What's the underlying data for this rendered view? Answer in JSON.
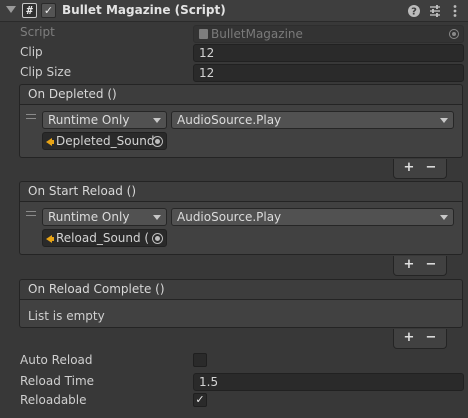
{
  "component": {
    "title": "Bullet Magazine (Script)",
    "enabled_check": "✓",
    "script_glyph": "#",
    "header_icons": [
      "help-icon",
      "preset-sliders-icon",
      "context-menu-icon"
    ]
  },
  "props": {
    "script_label": "Script",
    "script_value": "BulletMagazine",
    "clip_label": "Clip",
    "clip_value": "12",
    "clip_size_label": "Clip Size",
    "clip_size_value": "12",
    "auto_reload_label": "Auto Reload",
    "auto_reload_checked": false,
    "reload_time_label": "Reload Time",
    "reload_time_value": "1.5",
    "reloadable_label": "Reloadable",
    "reloadable_check": "✓"
  },
  "events": {
    "depleted": {
      "header": "On Depleted ()",
      "mode": "Runtime Only",
      "function": "AudioSource.Play",
      "target": "Depleted_Sound"
    },
    "start_reload": {
      "header": "On Start Reload ()",
      "mode": "Runtime Only",
      "function": "AudioSource.Play",
      "target": "Reload_Sound ("
    },
    "reload_complete": {
      "header": "On Reload Complete ()",
      "empty_text": "List is empty"
    }
  },
  "buttons": {
    "plus": "+",
    "minus": "−"
  },
  "colors": {
    "background": "#383838",
    "field": "#2a2a2a",
    "audio_icon": "#e8a416"
  }
}
